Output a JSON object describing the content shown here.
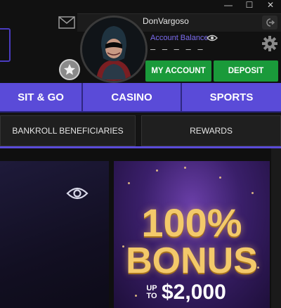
{
  "window": {
    "minimize_glyph": "—",
    "maximize_glyph": "☐",
    "close_glyph": "✕"
  },
  "user": {
    "name": "DonVargoso",
    "balance_label": "Account Balance",
    "balance_value": "– – – – –"
  },
  "buttons": {
    "my_account": "MY ACCOUNT",
    "deposit": "DEPOSIT"
  },
  "nav": {
    "tabs": [
      {
        "label": "SIT & GO"
      },
      {
        "label": "CASINO"
      },
      {
        "label": "SPORTS"
      }
    ]
  },
  "subnav": {
    "tabs": [
      {
        "label": "BANKROLL BENEFICIARIES"
      },
      {
        "label": "REWARDS"
      }
    ]
  },
  "promo": {
    "line1": "100%",
    "line2": "BONUS",
    "upto": "UP TO",
    "amount": "$2,000"
  },
  "colors": {
    "accent_purple": "#5a4bd8",
    "button_green": "#1a9a3a",
    "gold": "#f3c96a"
  },
  "icons": {
    "mail": "mail-icon",
    "logout": "logout-icon",
    "eye": "eye-icon",
    "gear": "gear-icon",
    "star": "star-icon"
  }
}
